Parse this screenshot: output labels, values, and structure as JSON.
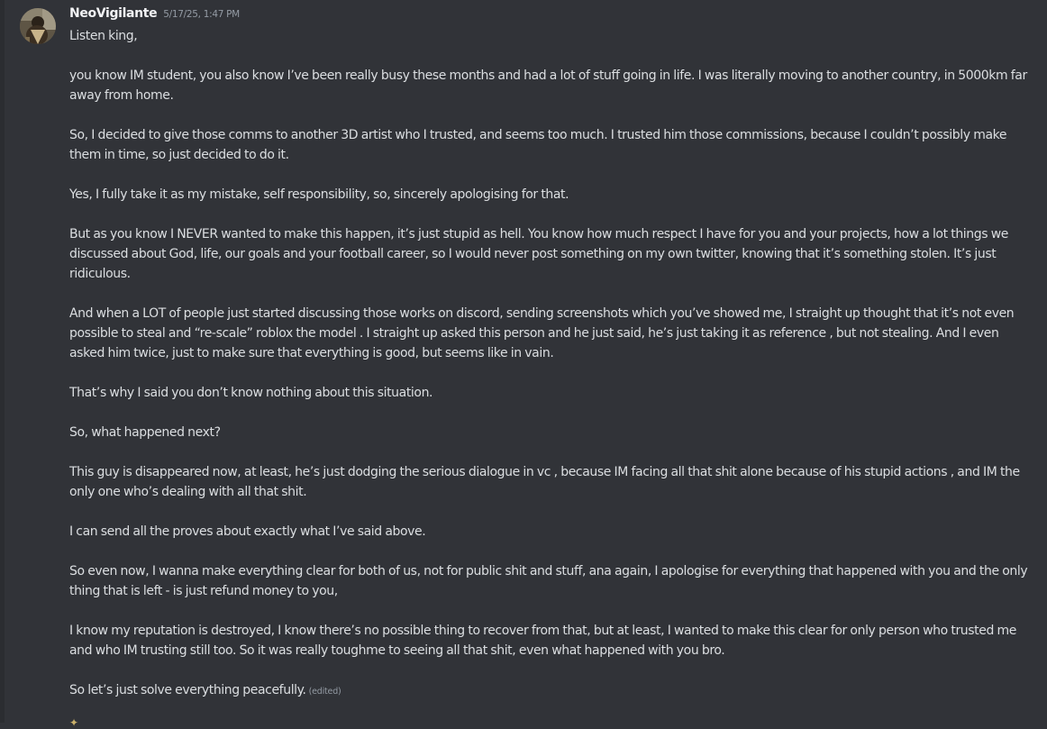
{
  "message": {
    "author": "NeoVigilante",
    "timestamp": "5/17/25, 1:47 PM",
    "edited_label": "(edited)",
    "paragraphs": [
      "Listen king,",
      "you know IM student, you also know I’ve been really busy these months and had a lot of stuff going in life. I was literally moving to another country, in 5000km far away from home.",
      "So, I decided to give those comms to another 3D artist who I trusted, and seems too much. I trusted him those commissions, because I couldn’t possibly make them in time, so just decided to do it.",
      "Yes, I fully take it as my mistake, self responsibility, so, sincerely apologising for that.",
      "But as you know I NEVER wanted to make this happen, it’s just stupid as hell. You know how much respect I have for you and your projects, how a lot things we discussed about God, life, our goals and your football career, so I would never post something on my own twitter, knowing that it’s something stolen. It’s just ridiculous.",
      "And when a LOT of people just started discussing those works on discord, sending screenshots which you’ve showed me, I straight up thought  that it’s not even possible to steal and “re-scale” roblox the model . I straight up asked this person and he just said, he’s just taking it as reference , but not stealing. And I even asked him twice, just to make sure that everything is good, but seems like in vain.",
      "That’s why I said you don’t know nothing about this situation.",
      "So, what happened next?",
      "This guy is disappeared now, at least, he’s just dodging the serious dialogue in vc , because IM facing all that shit alone because of his stupid actions , and IM the only one who’s dealing with all that shit.",
      "I can send all the proves about exactly what I’ve said above.",
      "So even now, I wanna make everything clear for both of us, not for public shit and stuff, ana again, I apologise for everything that happened with you and the only thing that is left - is just refund money to you,",
      "I know my reputation is destroyed, I know there’s no possible thing to recover from that, but at least, I wanted to make this clear for only person who trusted me and who IM trusting still too. So it was really toughme to seeing all that shit, even what happened with you bro.",
      "So let’s just solve everything peacefully."
    ]
  },
  "colors": {
    "background": "#313338",
    "username": "#f2f3f5",
    "text": "#dbdee1",
    "muted": "#949ba4"
  },
  "icons": {
    "avatar": "user-avatar-image",
    "partial_next": "emoji-peek-icon"
  }
}
